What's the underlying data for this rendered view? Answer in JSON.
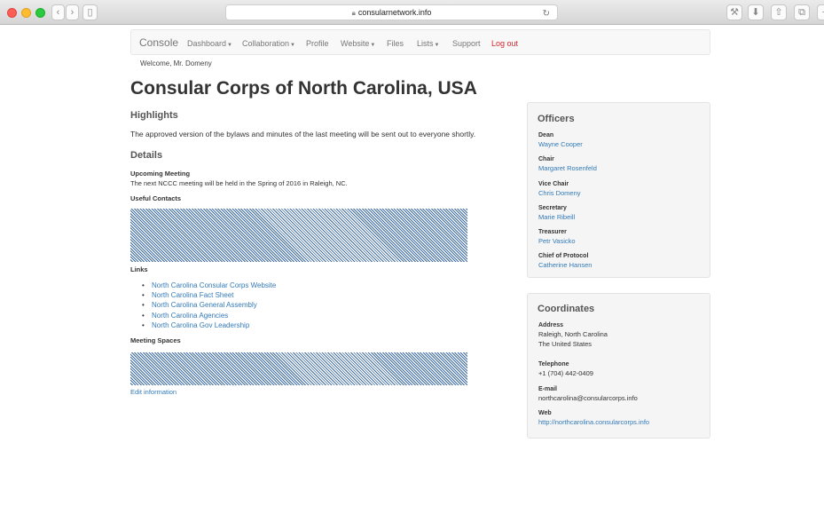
{
  "browser": {
    "url": "consularnetwork.info"
  },
  "nav": {
    "brand": "Console",
    "items": [
      "Dashboard",
      "Collaboration",
      "Profile",
      "Website",
      "Files",
      "Lists",
      "Support"
    ],
    "logout": "Log out"
  },
  "welcome": "Welcome, Mr. Domeny",
  "page_title": "Consular Corps of North Carolina, USA",
  "highlights": {
    "heading": "Highlights",
    "text": "The approved version of the bylaws and minutes of the last meeting will be sent out to everyone shortly."
  },
  "details": {
    "heading": "Details",
    "upcoming_label": "Upcoming Meeting",
    "upcoming_text": "The next NCCC meeting will be held in the Spring of 2016 in Raleigh, NC.",
    "contacts_label": "Useful Contacts",
    "links_label": "Links",
    "links": [
      "North Carolina Consular Corps Website",
      "North Carolina Fact Sheet",
      "North Carolina General Assembly",
      "North Carolina Agencies",
      "North Carolina Gov Leadership"
    ],
    "spaces_label": "Meeting Spaces",
    "edit": "Edit information"
  },
  "officers": {
    "heading": "Officers",
    "list": [
      {
        "role": "Dean",
        "name": "Wayne Cooper"
      },
      {
        "role": "Chair",
        "name": "Margaret Rosenfeld"
      },
      {
        "role": "Vice Chair",
        "name": "Chris Domeny"
      },
      {
        "role": "Secretary",
        "name": "Marie Ribeill"
      },
      {
        "role": "Treasurer",
        "name": "Petr Vasicko"
      },
      {
        "role": "Chief of Protocol",
        "name": "Catherine Hansen"
      }
    ]
  },
  "coordinates": {
    "heading": "Coordinates",
    "address_label": "Address",
    "address_line1": "Raleigh, North Carolina",
    "address_line2": "The United States",
    "telephone_label": "Telephone",
    "telephone": "+1 (704) 442-0409",
    "email_label": "E-mail",
    "email": "northcarolina@consularcorps.info",
    "web_label": "Web",
    "web": "http://northcarolina.consularcorps.info"
  }
}
